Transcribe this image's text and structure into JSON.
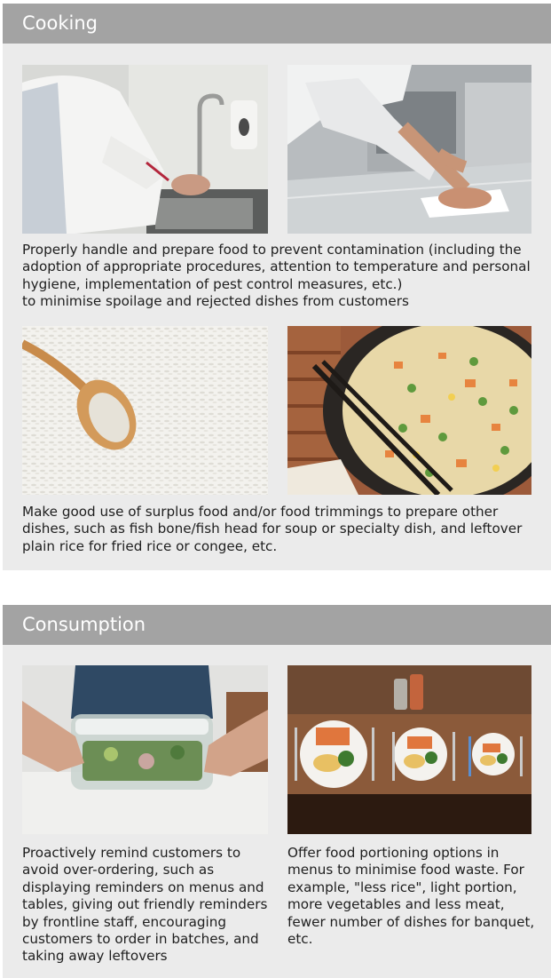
{
  "cooking": {
    "title": "Cooking",
    "caption1": "Properly handle and prepare food to prevent contamination (including the adoption of appropriate procedures, attention to temperature and personal hygiene, implementation of pest control measures, etc.)",
    "caption1b": "to minimise spoilage and rejected dishes from customers",
    "caption2": "Make good use of surplus food and/or food trimmings to prepare other dishes, such as fish bone/fish head for soup or specialty dish, and leftover plain rice for fried rice or congee, etc."
  },
  "consumption": {
    "title": "Consumption",
    "caption_left": "Proactively remind customers to avoid over-ordering, such as displaying reminders on menus and tables, giving out friendly reminders by frontline staff, encouraging customers to order in batches, and taking away leftovers",
    "caption_right": "Offer food portioning options in menus to minimise food waste. For example, \"less rice\", light portion, more vegetables and less meat, fewer number of dishes for banquet, etc."
  }
}
